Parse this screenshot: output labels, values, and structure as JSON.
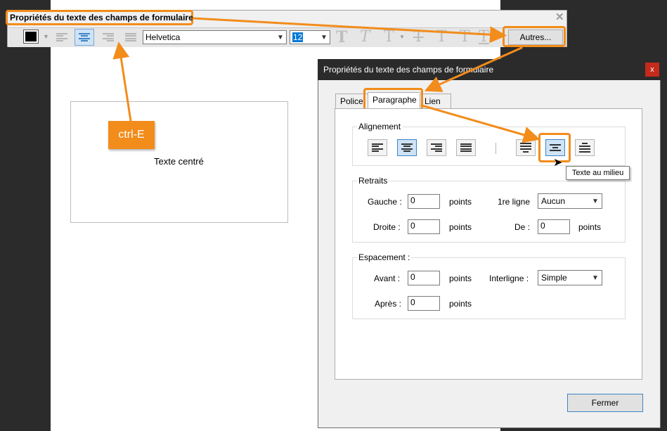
{
  "toolbar": {
    "title": "Propriétés du texte des champs de formulaire",
    "font": "Helvetica",
    "size": "12",
    "more_label": "Autres..."
  },
  "canvas": {
    "sample_text": "Texte centré"
  },
  "callout": {
    "shortcut": "ctrl-E"
  },
  "dialog": {
    "title": "Propriétés du texte des champs de formulaire",
    "close_label": "x",
    "tabs": [
      "Police",
      "Paragraphe",
      "Lien"
    ],
    "alignment": {
      "label": "Alignement"
    },
    "indents": {
      "label": "Retraits",
      "left_label": "Gauche :",
      "left_value": "0",
      "right_label": "Droite :",
      "right_value": "0",
      "unit": "points",
      "first_line_label": "1re ligne",
      "first_line_value": "Aucun",
      "by_label": "De :",
      "by_value": "0"
    },
    "spacing": {
      "label": "Espacement :",
      "before_label": "Avant :",
      "before_value": "0",
      "after_label": "Après :",
      "after_value": "0",
      "unit": "points",
      "line_spacing_label": "Interligne :",
      "line_spacing_value": "Simple"
    },
    "tooltip": "Texte au milieu",
    "close_button": "Fermer"
  },
  "colors": {
    "accent": "#f28c1b",
    "selected": "#cfe3f6"
  },
  "icons": [
    "color-swatch-icon",
    "align-left-icon",
    "align-center-icon",
    "align-right-icon",
    "justify-icon",
    "text-style-icon",
    "valign-top-icon",
    "valign-middle-icon",
    "valign-bottom-icon"
  ]
}
